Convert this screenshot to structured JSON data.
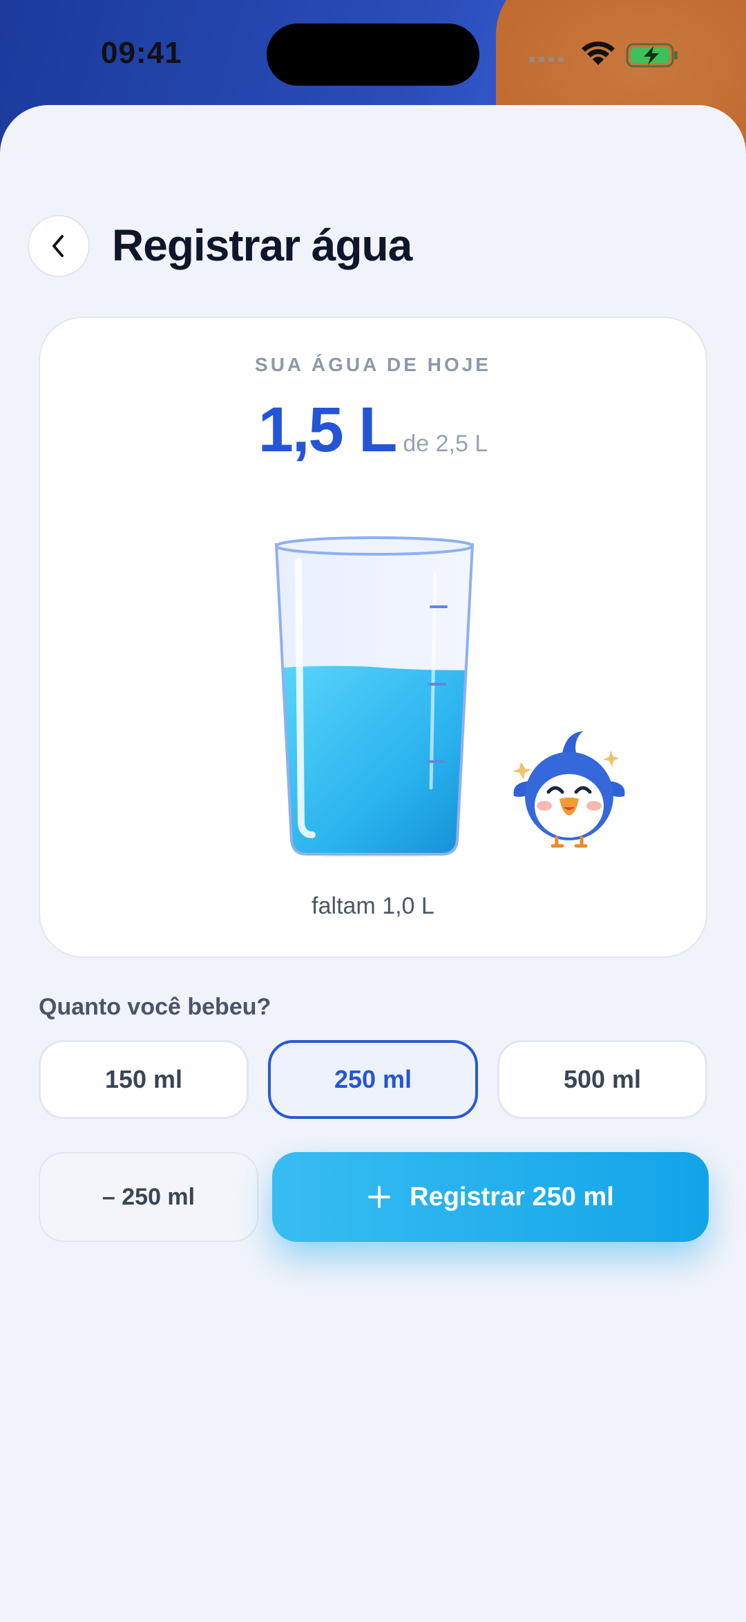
{
  "status_bar": {
    "time": "09:41"
  },
  "header": {
    "title": "Registrar água",
    "back_icon": "chevron-left-icon"
  },
  "today_card": {
    "label": "SUA ÁGUA DE HOJE",
    "amount": "1,5 L",
    "goal": "de 2,5 L",
    "fill_fraction": 0.6,
    "remaining": "faltam 1,0 L",
    "mascot": "bird-mascot-icon"
  },
  "quick_add": {
    "question": "Quanto você bebeu?",
    "options": [
      {
        "label": "150 ml",
        "selected": false
      },
      {
        "label": "250 ml",
        "selected": true
      },
      {
        "label": "500 ml",
        "selected": false
      }
    ]
  },
  "actions": {
    "minus_label": "– 250 ml",
    "register_label": "Registrar 250 ml",
    "register_icon": "plus-icon"
  },
  "colors": {
    "accent": "#2455d6",
    "water": "#2bb4f0",
    "register": "#18a9ec"
  }
}
